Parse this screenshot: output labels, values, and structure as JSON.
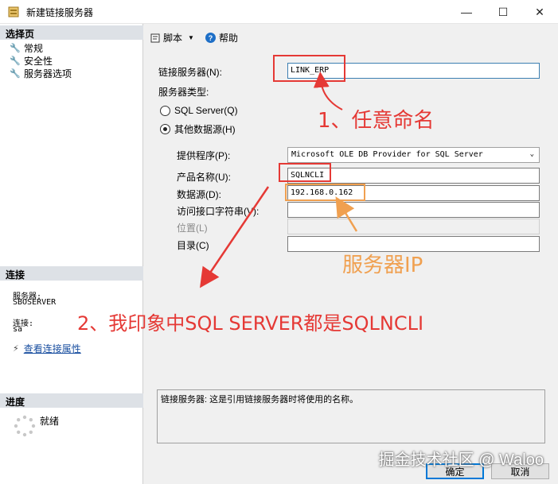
{
  "window": {
    "title": "新建链接服务器",
    "minimize": "—",
    "maximize": "☐",
    "close": "✕"
  },
  "left": {
    "select_page_header": "选择页",
    "pages": [
      "常规",
      "安全性",
      "服务器选项"
    ],
    "connection_header": "连接",
    "server_label": "服务器:",
    "server_value": "SBOSERVER",
    "conn_label": "连接:",
    "conn_value": "sa",
    "view_props_link": "查看连接属性",
    "progress_header": "进度",
    "progress_status": "就绪"
  },
  "toolbar": {
    "script_label": "脚本",
    "help_label": "帮助"
  },
  "form": {
    "linked_server_label": "链接服务器(N):",
    "linked_server_value": "LINK_ERP",
    "server_type_label": "服务器类型:",
    "radio_sql_server": "SQL Server(Q)",
    "radio_other": "其他数据源(H)",
    "provider_label": "提供程序(P):",
    "provider_value": "Microsoft OLE DB Provider for SQL Server",
    "product_label": "产品名称(U):",
    "product_value": "SQLNCLI",
    "datasource_label": "数据源(D):",
    "datasource_value": "192.168.0.162",
    "provider_string_label": "访问接口字符串(V):",
    "provider_string_value": "",
    "location_label": "位置(L)",
    "location_value": "",
    "catalog_label": "目录(C)",
    "catalog_value": ""
  },
  "description": "链接服务器: 这是引用链接服务器时将使用的名称。",
  "buttons": {
    "ok": "确定",
    "cancel": "取消"
  },
  "annotations": {
    "note1": "1、任意命名",
    "note_ip": "服务器IP",
    "note2": "2、我印象中SQL SERVER都是SQLNCLI"
  },
  "watermark": "掘金技术社区 @ Waloo",
  "colors": {
    "annotation_red": "#e53935",
    "annotation_orange": "#f0a050",
    "default_button_border": "#0078d7"
  }
}
